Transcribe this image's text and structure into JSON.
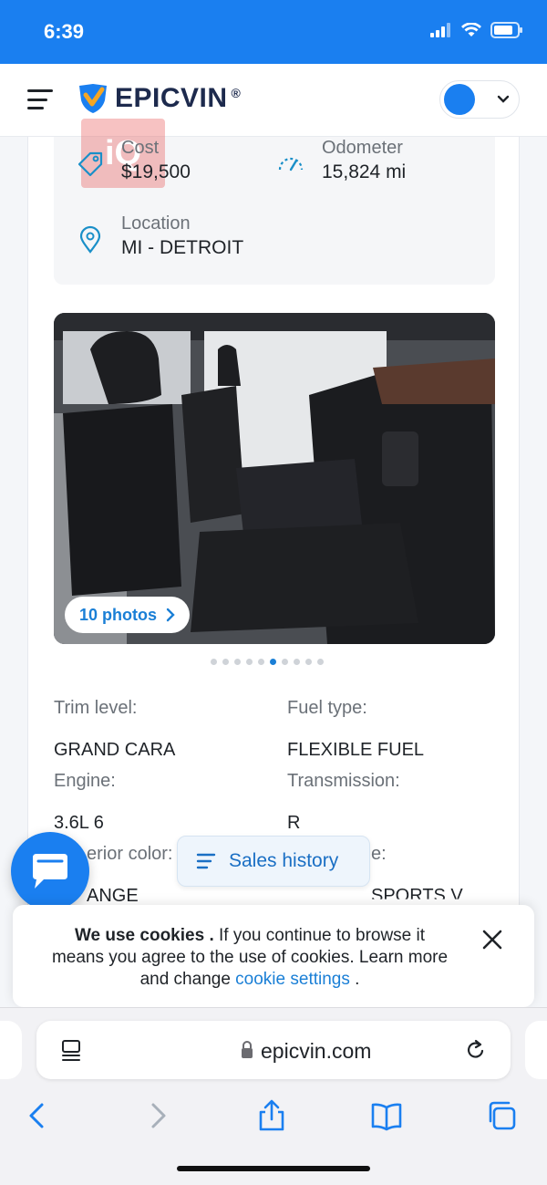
{
  "status_bar": {
    "time": "6:39"
  },
  "header": {
    "logo_text_epic": "EPIC",
    "logo_text_vin": "VIN",
    "logo_reg": "®"
  },
  "vehicle_info": {
    "cost_label": "Cost",
    "cost_value": "$19,500",
    "odometer_label": "Odometer",
    "odometer_value": "15,824 mi",
    "location_label": "Location",
    "location_value": "MI - DETROIT",
    "watermark": "iQ"
  },
  "gallery": {
    "photos_button": "10 photos",
    "dot_count": 10,
    "active_dot": 6
  },
  "specs": {
    "trim_label": "Trim level:",
    "trim_value": "GRAND CARA",
    "fuel_label": "Fuel type:",
    "fuel_value": "FLEXIBLE FUEL",
    "engine_label": "Engine:",
    "engine_value": "3.6L 6",
    "transmission_label": "Transmission:",
    "transmission_value": "R",
    "exterior_label_partial": "erior color:",
    "exterior_value_partial": "ANGE",
    "style_label_partial": "e:",
    "style_value_partial": "SPORTS V"
  },
  "sales_history": {
    "label": "Sales history"
  },
  "cookie_banner": {
    "bold": "We use cookies .",
    "text": " If you continue to browse it means you agree to the use of cookies. Learn more and change ",
    "link": "cookie settings",
    "end": " ."
  },
  "browser": {
    "url": "epicvin.com"
  },
  "colors": {
    "brand_blue": "#1a7ff0",
    "link_blue": "#1a7fd6",
    "icon_teal": "#1a8fc8"
  }
}
